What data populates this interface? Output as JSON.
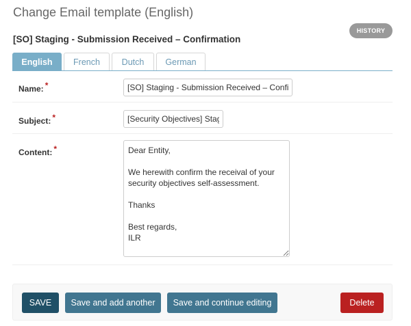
{
  "header": {
    "page_title": "Change Email template (English)",
    "object_title": "[SO] Staging - Submission Received – Confirmation",
    "history_label": "HISTORY"
  },
  "tabs": [
    {
      "label": "English",
      "active": true
    },
    {
      "label": "French",
      "active": false
    },
    {
      "label": "Dutch",
      "active": false
    },
    {
      "label": "German",
      "active": false
    }
  ],
  "form": {
    "name": {
      "label": "Name:",
      "required_mark": "*",
      "value": "[SO] Staging - Submission Received – Confirmation"
    },
    "subject": {
      "label": "Subject:",
      "required_mark": "*",
      "value": "[Security Objectives] Staging - Submission Received"
    },
    "content": {
      "label": "Content:",
      "required_mark": "*",
      "value": "Dear Entity,\n\nWe herewith confirm the receival of your security objectives self-assessment.\n\nThanks\n\nBest regards,\nILR"
    }
  },
  "actions": {
    "save": "SAVE",
    "save_add_another": "Save and add another",
    "save_continue": "Save and continue editing",
    "delete": "Delete"
  },
  "colors": {
    "tab_active": "#79aec8",
    "button_primary": "#417690",
    "button_save": "#205067",
    "button_delete": "#ba2121"
  }
}
